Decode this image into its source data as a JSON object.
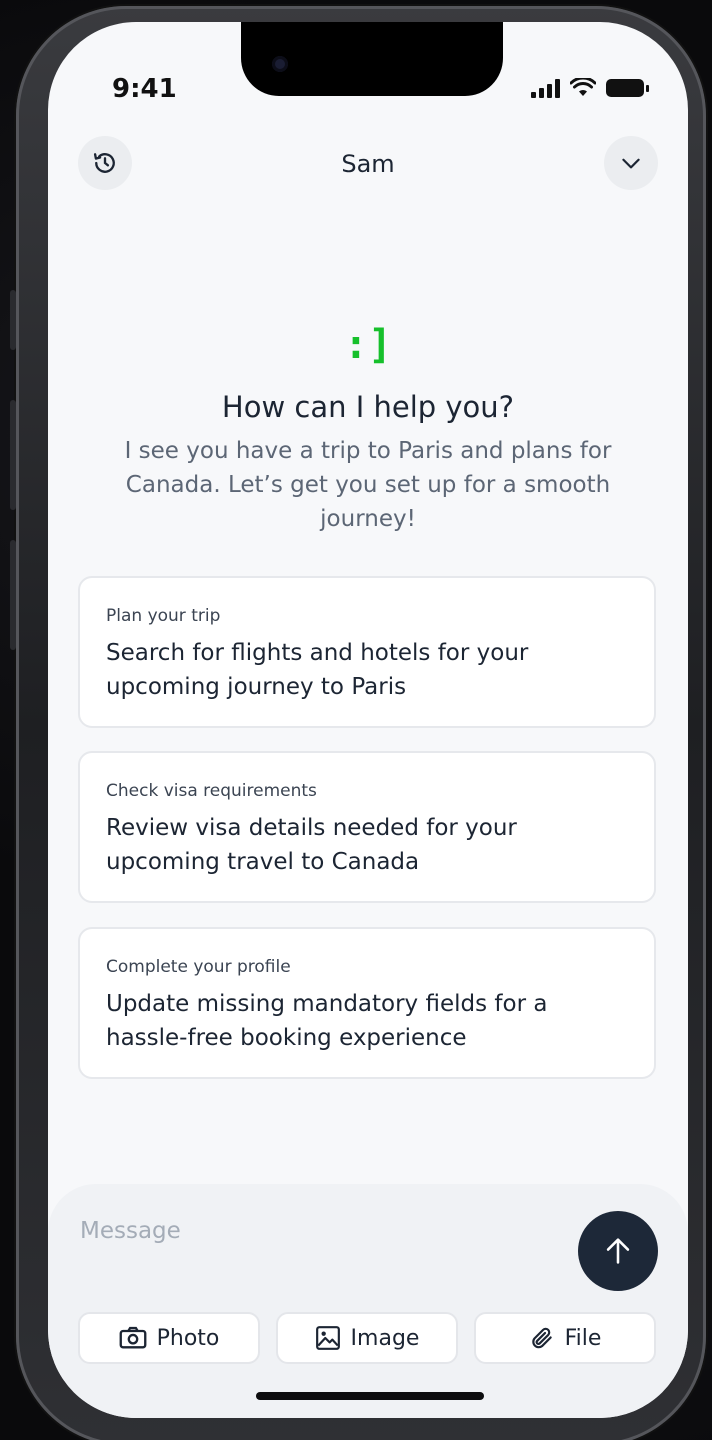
{
  "status_bar": {
    "time": "9:41"
  },
  "header": {
    "title": "Sam"
  },
  "hero": {
    "logo": ":]",
    "title": "How can I help you?",
    "subtitle": "I see you have a trip to Paris and plans for Canada. Let’s get you set up for a smooth journey!"
  },
  "suggestions": [
    {
      "label": "Plan your trip",
      "text": "Search for flights and hotels for your upcoming journey to Paris"
    },
    {
      "label": "Check visa requirements",
      "text": "Review visa details needed for your upcoming travel to Canada"
    },
    {
      "label": "Complete your profile",
      "text": "Update missing mandatory fields for a hassle-free booking experience"
    }
  ],
  "composer": {
    "placeholder": "Message",
    "attachments": [
      {
        "label": "Photo",
        "icon": "camera-icon"
      },
      {
        "label": "Image",
        "icon": "image-icon"
      },
      {
        "label": "File",
        "icon": "paperclip-icon"
      }
    ]
  },
  "colors": {
    "accent": "#16c02b",
    "send_button": "#1d2838",
    "background": "#f7f8fa"
  }
}
